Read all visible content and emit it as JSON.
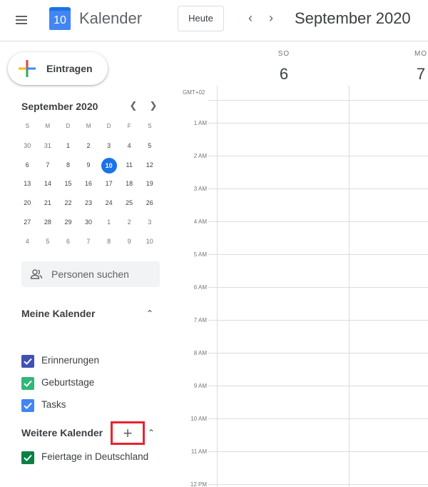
{
  "header": {
    "app_name": "Kalender",
    "logo_day": "10",
    "today_label": "Heute",
    "prev_label": "‹",
    "next_label": "›",
    "period": "September 2020"
  },
  "sidebar": {
    "create_label": "Eintragen",
    "mini_calendar": {
      "title": "September 2020",
      "weekdays": [
        "S",
        "M",
        "D",
        "M",
        "D",
        "F",
        "S"
      ],
      "weeks": [
        [
          "30",
          "31",
          "1",
          "2",
          "3",
          "4",
          "5"
        ],
        [
          "6",
          "7",
          "8",
          "9",
          "10",
          "11",
          "12"
        ],
        [
          "13",
          "14",
          "15",
          "16",
          "17",
          "18",
          "19"
        ],
        [
          "20",
          "21",
          "22",
          "23",
          "24",
          "25",
          "26"
        ],
        [
          "27",
          "28",
          "29",
          "30",
          "1",
          "2",
          "3"
        ],
        [
          "4",
          "5",
          "6",
          "7",
          "8",
          "9",
          "10"
        ]
      ],
      "today": "10"
    },
    "people_search_label": "Personen suchen",
    "my_calendars": {
      "title": "Meine Kalender",
      "items": [
        {
          "label": "Erinnerungen",
          "color": "#3f51b5"
        },
        {
          "label": "Geburtstage",
          "color": "#33b679"
        },
        {
          "label": "Tasks",
          "color": "#4285f4"
        }
      ]
    },
    "other_calendars": {
      "title": "Weitere Kalender",
      "add_label": "+",
      "items": [
        {
          "label": "Feiertage in Deutschland",
          "color": "#0b8043"
        }
      ]
    }
  },
  "main": {
    "days": [
      {
        "dow": "SO",
        "num": "6"
      },
      {
        "dow": "MO",
        "num": "7"
      }
    ],
    "timezone": "GMT+02",
    "hours": [
      "1 AM",
      "2 AM",
      "3 AM",
      "4 AM",
      "5 AM",
      "6 AM",
      "7 AM",
      "8 AM",
      "9 AM",
      "10 AM",
      "11 AM",
      "12 PM"
    ]
  },
  "colors": {
    "accent": "#1a73e8",
    "highlight_box": "#e8242f"
  }
}
